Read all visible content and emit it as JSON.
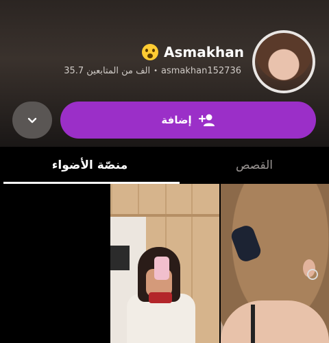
{
  "profile": {
    "name": "Asmakhan",
    "username": "asmakhan152736",
    "followers": "35.7 الف من المتابعين"
  },
  "actions": {
    "add_label": "إضافة",
    "add_icon": "add-friend-icon",
    "more_icon": "chevron-down-icon"
  },
  "tabs": {
    "spotlight": "منصّة الأضواء",
    "stories": "القصص"
  },
  "colors": {
    "accent": "#9b2fc8"
  }
}
